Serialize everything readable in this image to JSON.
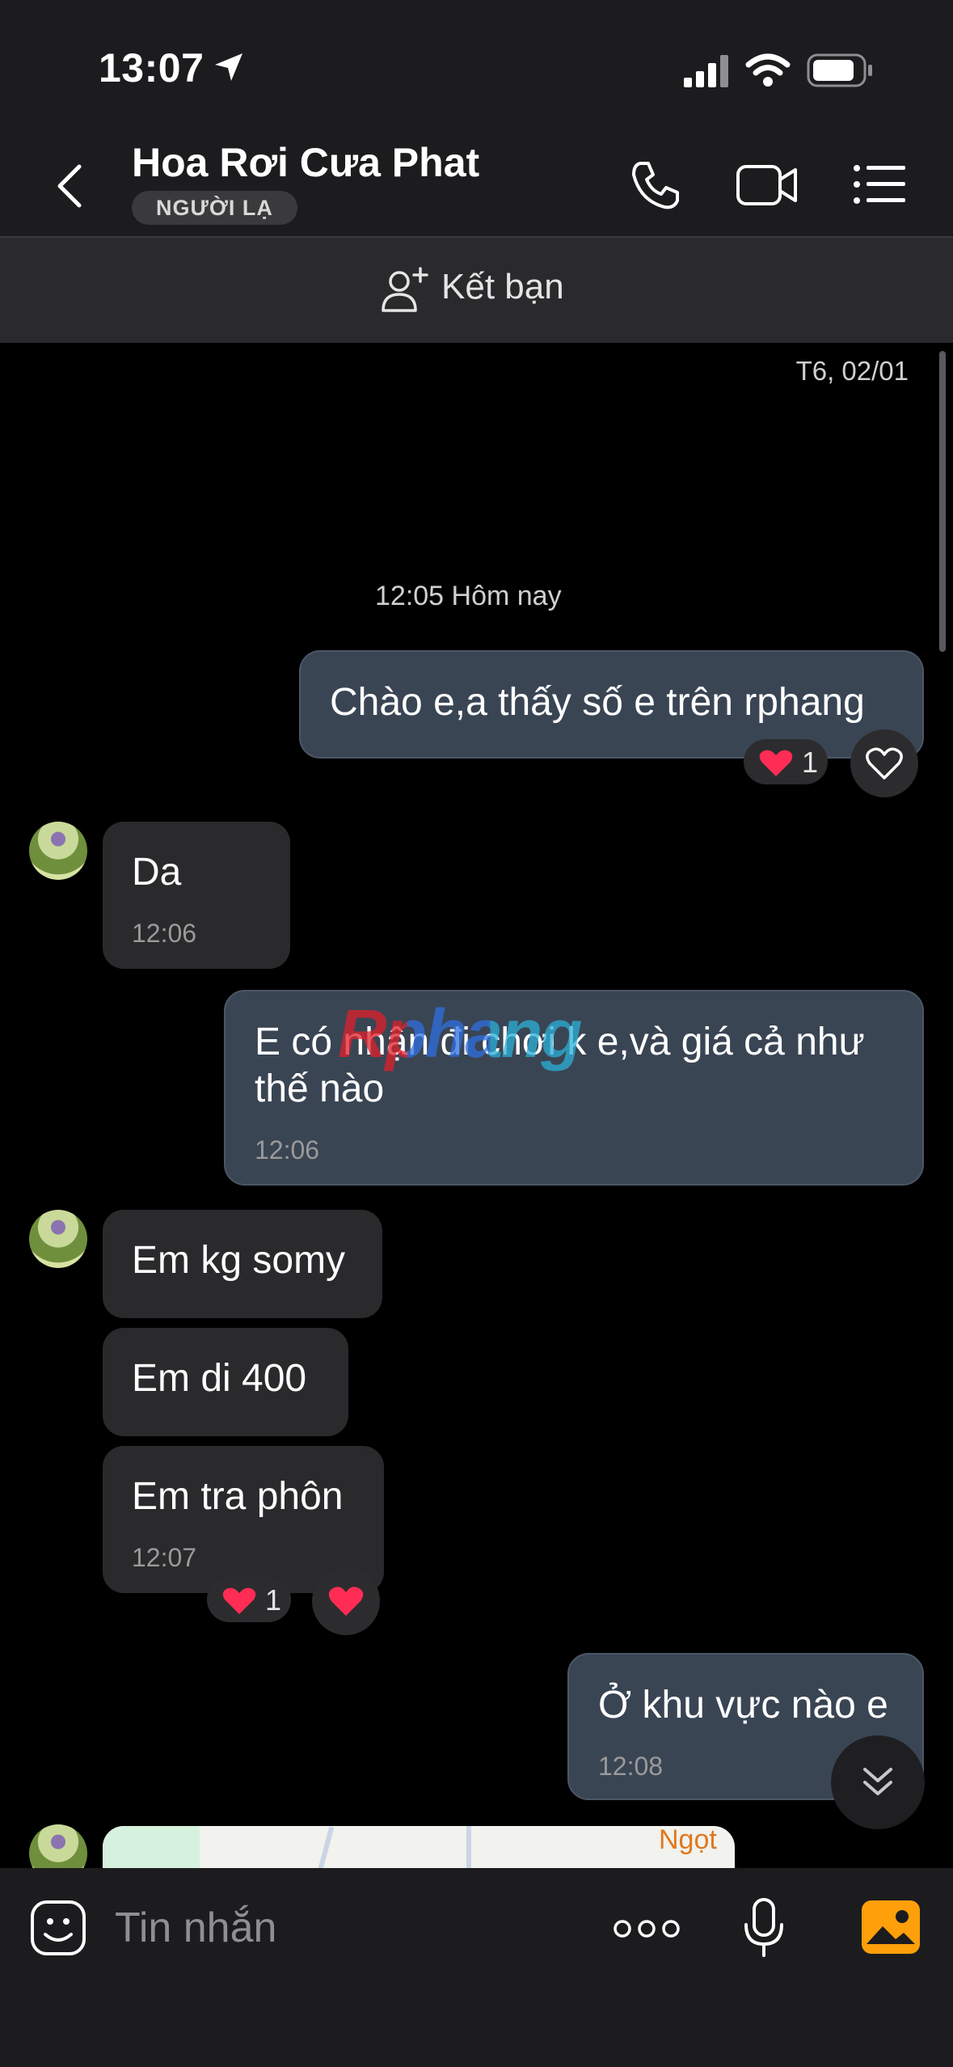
{
  "status": {
    "time": "13:07"
  },
  "header": {
    "title": "Hoa Rơi Cưa Phat",
    "badge": "NGƯỜI LẠ"
  },
  "friend_bar": {
    "label": "Kết bạn"
  },
  "chat": {
    "date_label": "T6, 02/01",
    "time_divider": "12:05 Hôm nay",
    "messages": [
      {
        "from": "me",
        "text": "Chào e,a thấy số e trên rphang",
        "time": "",
        "reaction_count": "1"
      },
      {
        "from": "them",
        "text": "Da",
        "time": "12:06"
      },
      {
        "from": "me",
        "text": "E có nhận đi chơi k e,và giá cả như thế nào",
        "time": "12:06"
      },
      {
        "from": "them",
        "text": "Em kg somy",
        "time": ""
      },
      {
        "from": "them",
        "text": "Em di 400",
        "time": ""
      },
      {
        "from": "them",
        "text": "Em tra phôn",
        "time": "12:07",
        "reaction_count": "1"
      },
      {
        "from": "me",
        "text": "Ở khu vực nào e",
        "time": "12:08"
      }
    ],
    "map_preview_label": "Ngọt",
    "watermark": "Rphang"
  },
  "input": {
    "placeholder": "Tin nhắn"
  },
  "colors": {
    "outgoing_bubble": "#3a4554",
    "incoming_bubble": "#2a2a2c",
    "accent_gallery": "#ff9f0a",
    "heart": "#ff2d55"
  }
}
